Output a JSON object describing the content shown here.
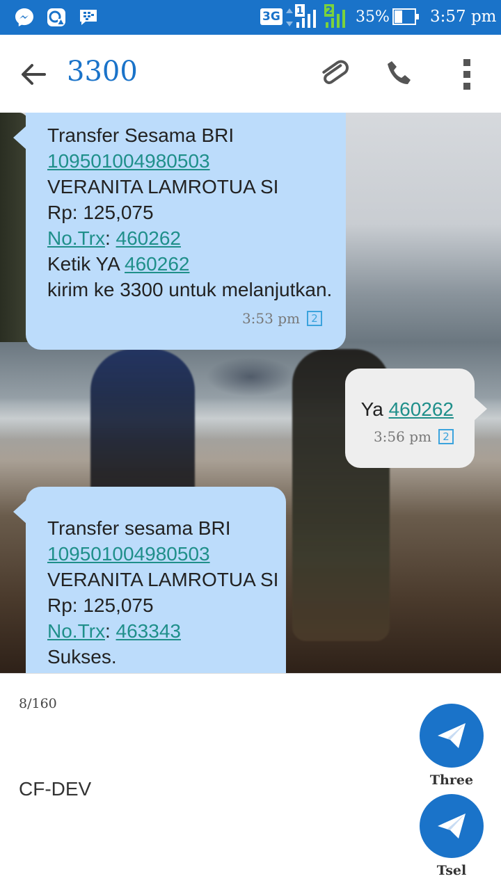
{
  "status_bar": {
    "network_type": "3G",
    "sim1_label": "1",
    "sim2_label": "2",
    "battery_percent": "35%",
    "battery_level": 0.35,
    "time": "3:57 pm",
    "icons": [
      "messenger-icon",
      "gallery-alert-icon",
      "bbm-icon"
    ]
  },
  "toolbar": {
    "title": "3300",
    "back_icon": "arrow-left-icon",
    "attach_icon": "paperclip-icon",
    "call_icon": "phone-icon",
    "menu_icon": "more-vert-icon"
  },
  "messages": [
    {
      "direction": "incoming",
      "line1": "Transfer Sesama BRI",
      "account": "109501004980503",
      "name": "VERANITA LAMROTUA SI",
      "amount": "Rp: 125,075",
      "trx_label": "No.Trx",
      "trx_sep": ":",
      "trx": "460262",
      "confirm_prefix": "Ketik YA",
      "confirm_code": "460262",
      "instruction": "kirim ke 3300 untuk melanjutkan.",
      "time": "3:53 pm",
      "sim": "2"
    },
    {
      "direction": "outgoing",
      "prefix": "Ya",
      "code": "460262",
      "time": "3:56 pm",
      "sim": "2"
    },
    {
      "direction": "incoming",
      "line1": "Transfer sesama BRI",
      "account": "109501004980503",
      "name": "VERANITA LAMROTUA SI",
      "amount": "Rp: 125,075",
      "trx_label": "No.Trx",
      "trx_sep": ":",
      "trx": "463343",
      "result": "Sukses."
    }
  ],
  "compose": {
    "counter": "8/160",
    "text": "CF-DEV",
    "send_buttons": [
      {
        "label": "Three"
      },
      {
        "label": "Tsel"
      }
    ]
  },
  "colors": {
    "accent": "#1a73c9",
    "incoming_bubble": "#bcdcfb",
    "outgoing_bubble": "#eeeeee",
    "link": "#1f8f8a"
  }
}
